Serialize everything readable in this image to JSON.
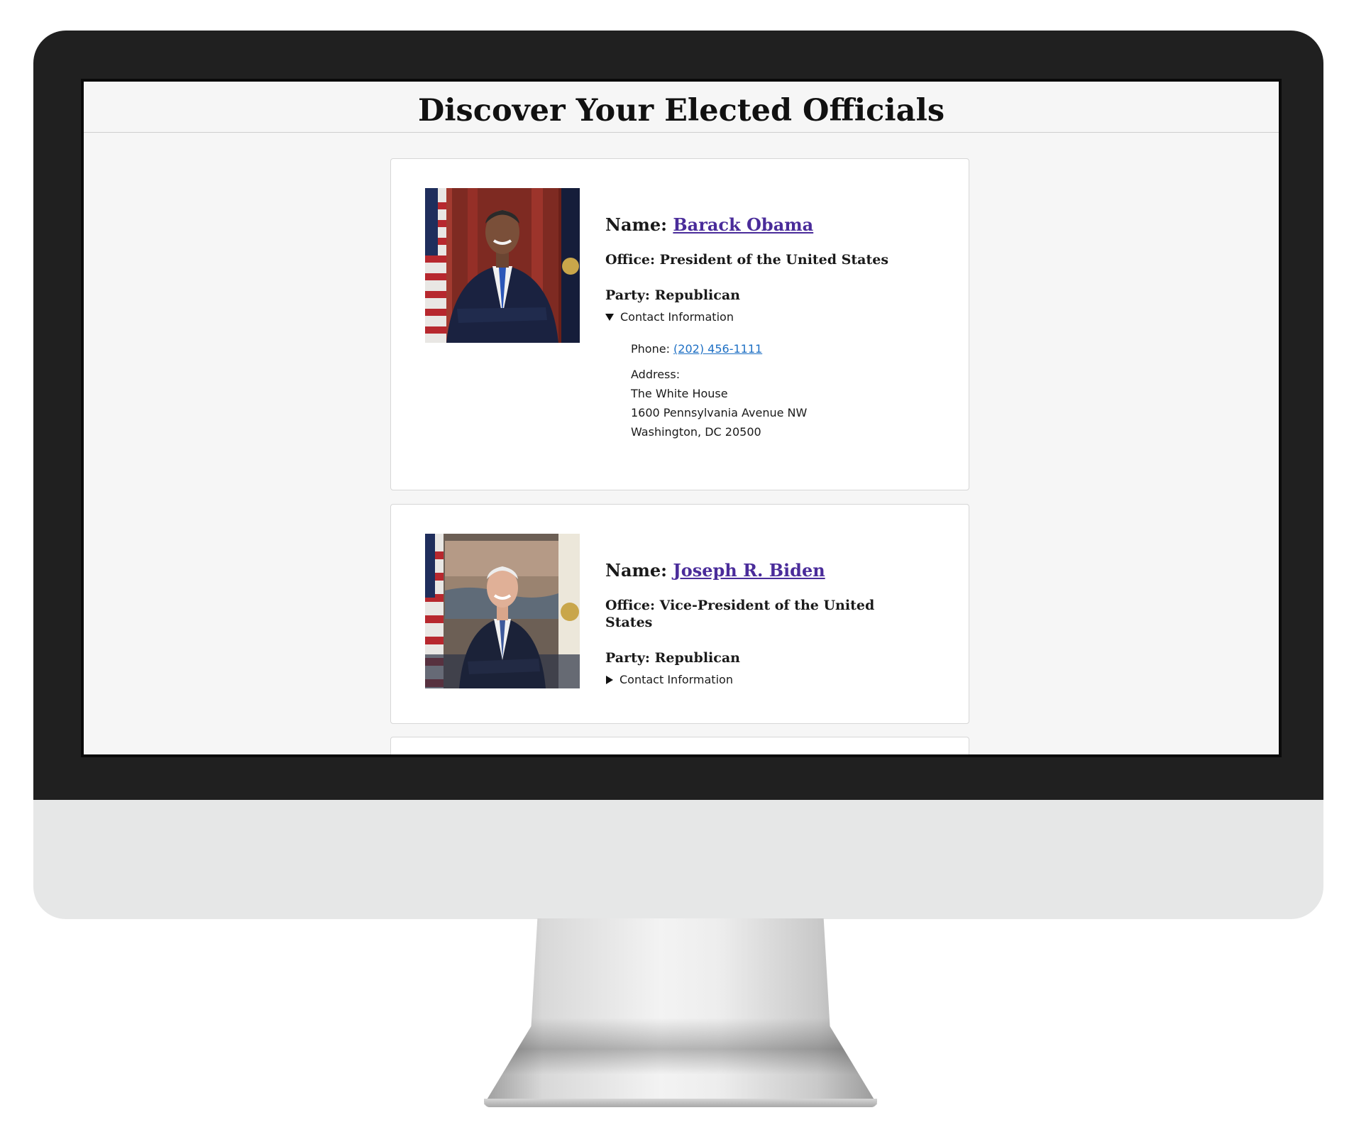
{
  "page": {
    "title": "Discover Your Elected Officials"
  },
  "officials": [
    {
      "name_label": "Name:",
      "name": "Barack Obama",
      "office_label": "Office:",
      "office": "President of the United States",
      "party_label": "Party:",
      "party": "Republican",
      "contact_toggle": "Contact Information",
      "contact_expanded": true,
      "phone_label": "Phone:",
      "phone": "(202) 456-1111",
      "address_label": "Address:",
      "address_lines": [
        "The White House",
        "1600 Pennsylvania Avenue NW",
        "Washington, DC 20500"
      ]
    },
    {
      "name_label": "Name:",
      "name": "Joseph R. Biden",
      "office_label": "Office:",
      "office": "Vice-President of the United States",
      "party_label": "Party:",
      "party": "Republican",
      "contact_toggle": "Contact Information",
      "contact_expanded": false
    }
  ],
  "colors": {
    "link_name": "#4a2c9a",
    "link_phone": "#1d6fc4",
    "page_bg": "#f6f6f6",
    "bezel": "#202020"
  }
}
